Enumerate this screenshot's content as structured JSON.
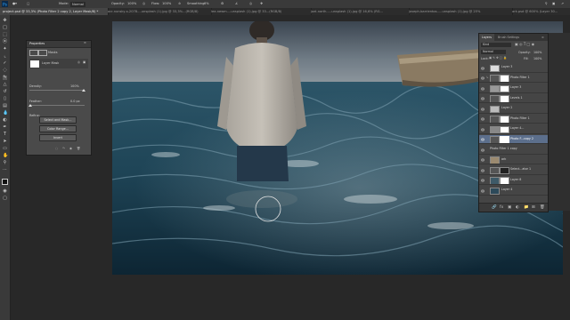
{
  "options_bar": {
    "mode_label": "Mode:",
    "mode_value": "Normal",
    "opacity_label": "Opacity:",
    "opacity_value": "100%",
    "flow_label": "Flow:",
    "flow_value": "100%",
    "smoothing_label": "Smoothing:",
    "smoothing_value": "0%"
  },
  "tabs": [
    {
      "label": "project.psd @ 33,3% (Photo Filter 2 copy 2, Layer Mask/8) *"
    },
    {
      "label": "ocr-nunsky-s-2078...-unsplash (1).jpg @ 33,3%...(RGB/8)"
    },
    {
      "label": "lee-newm...-unsplash (1).jpg @ 33...(RGB/8)"
    },
    {
      "label": "joel-north-...-unsplash (1).jpg @ 16,6% (RG..."
    },
    {
      "label": "joseph-barrientos-...-unsplash (1).jpg @ 25%"
    },
    {
      "label": "ark.psd @ 600% (Layer 30..."
    }
  ],
  "properties": {
    "title": "Properties",
    "section_label": "Masks",
    "mask_name": "Layer Mask",
    "density_label": "Density:",
    "density_value": "100%",
    "feather_label": "Feather:",
    "feather_value": "0.0 px",
    "refine_label": "Refine:",
    "btn_select_mask": "Select and Mask...",
    "btn_color_range": "Color Range...",
    "btn_invert": "Invert"
  },
  "layers": {
    "tab_layers": "Layers",
    "tab_brushes": "Brush Settings",
    "search_kind": "Kind",
    "blend_mode": "Normal",
    "opacity_label": "Opacity:",
    "opacity_value": "100%",
    "lock_label": "Lock:",
    "fill_label": "Fill:",
    "fill_value": "100%",
    "rows": [
      {
        "name": "Layer 3"
      },
      {
        "name": "Photo Filter 1"
      },
      {
        "name": "Layer 3"
      },
      {
        "name": "Levels 1"
      },
      {
        "name": "Layer 2"
      },
      {
        "name": "Photo Filter 1"
      },
      {
        "name": "Layer 4..."
      },
      {
        "name": "Photo F...copy 2"
      },
      {
        "name": "Photo Filter 1 copy"
      },
      {
        "name": "ark"
      },
      {
        "name": "Select...ator 1"
      },
      {
        "name": "Layer 8"
      },
      {
        "name": "Layer 4"
      }
    ]
  },
  "colors": {
    "app_bg": "#282828",
    "panel_bg": "#454545",
    "selection": "#5c6f8c"
  }
}
